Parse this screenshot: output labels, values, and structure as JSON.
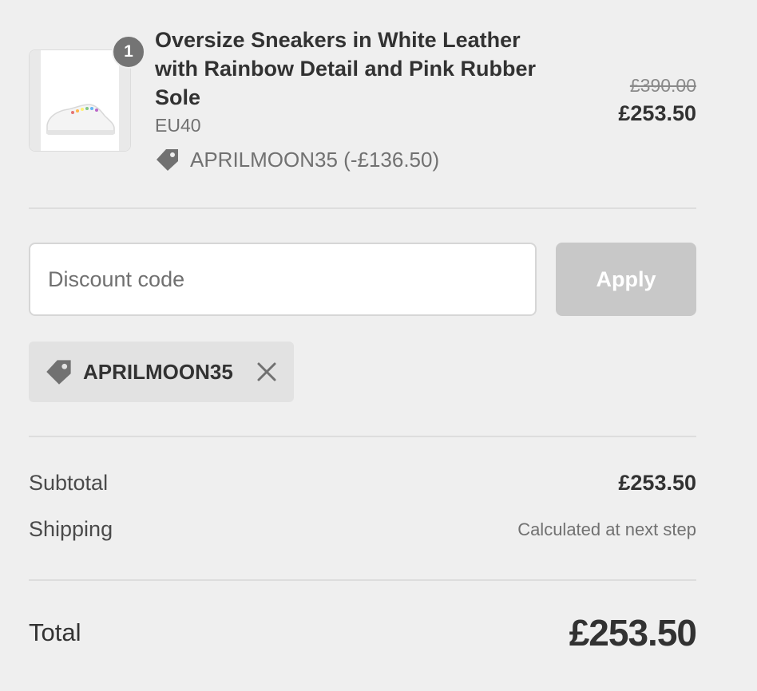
{
  "product": {
    "quantity": "1",
    "name": "Oversize Sneakers in White Leather with Rainbow Detail and Pink Rubber Sole",
    "variant": "EU40",
    "discount_label": "APRILMOON35 (-£136.50)",
    "original_price": "£390.00",
    "price": "£253.50",
    "image_icon": "sneaker-image"
  },
  "discount": {
    "placeholder": "Discount code",
    "value": "",
    "apply_label": "Apply",
    "applied_code": "APRILMOON35",
    "tag_icon": "tag-icon",
    "remove_icon": "close-icon"
  },
  "summary": {
    "subtotal_label": "Subtotal",
    "subtotal_value": "£253.50",
    "shipping_label": "Shipping",
    "shipping_value": "Calculated at next step",
    "total_label": "Total",
    "total_value": "£253.50"
  },
  "colors": {
    "background": "#efefef",
    "apply_button_disabled": "#c8c8c8",
    "tag_background": "#e2e2e2",
    "quantity_badge": "#747474"
  }
}
